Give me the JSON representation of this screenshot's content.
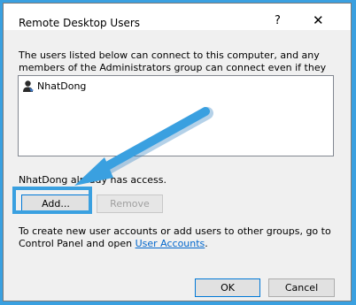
{
  "dialog": {
    "title": "Remote Desktop Users",
    "help_label": "?",
    "close_label": "✕"
  },
  "description": "The users listed below can connect to this computer, and any members of the Administrators group can connect even if they are not listed.",
  "users": [
    {
      "name": "NhatDong",
      "icon": "user-icon"
    }
  ],
  "access_text": "NhatDong already has access.",
  "buttons": {
    "add": "Add...",
    "remove": "Remove",
    "ok": "OK",
    "cancel": "Cancel"
  },
  "info": {
    "prefix": "To create new user accounts or add users to other groups, go to Control Panel and open ",
    "link": "User Accounts",
    "suffix": "."
  },
  "colors": {
    "annotation": "#3aa0e0",
    "link": "#0066cc"
  }
}
